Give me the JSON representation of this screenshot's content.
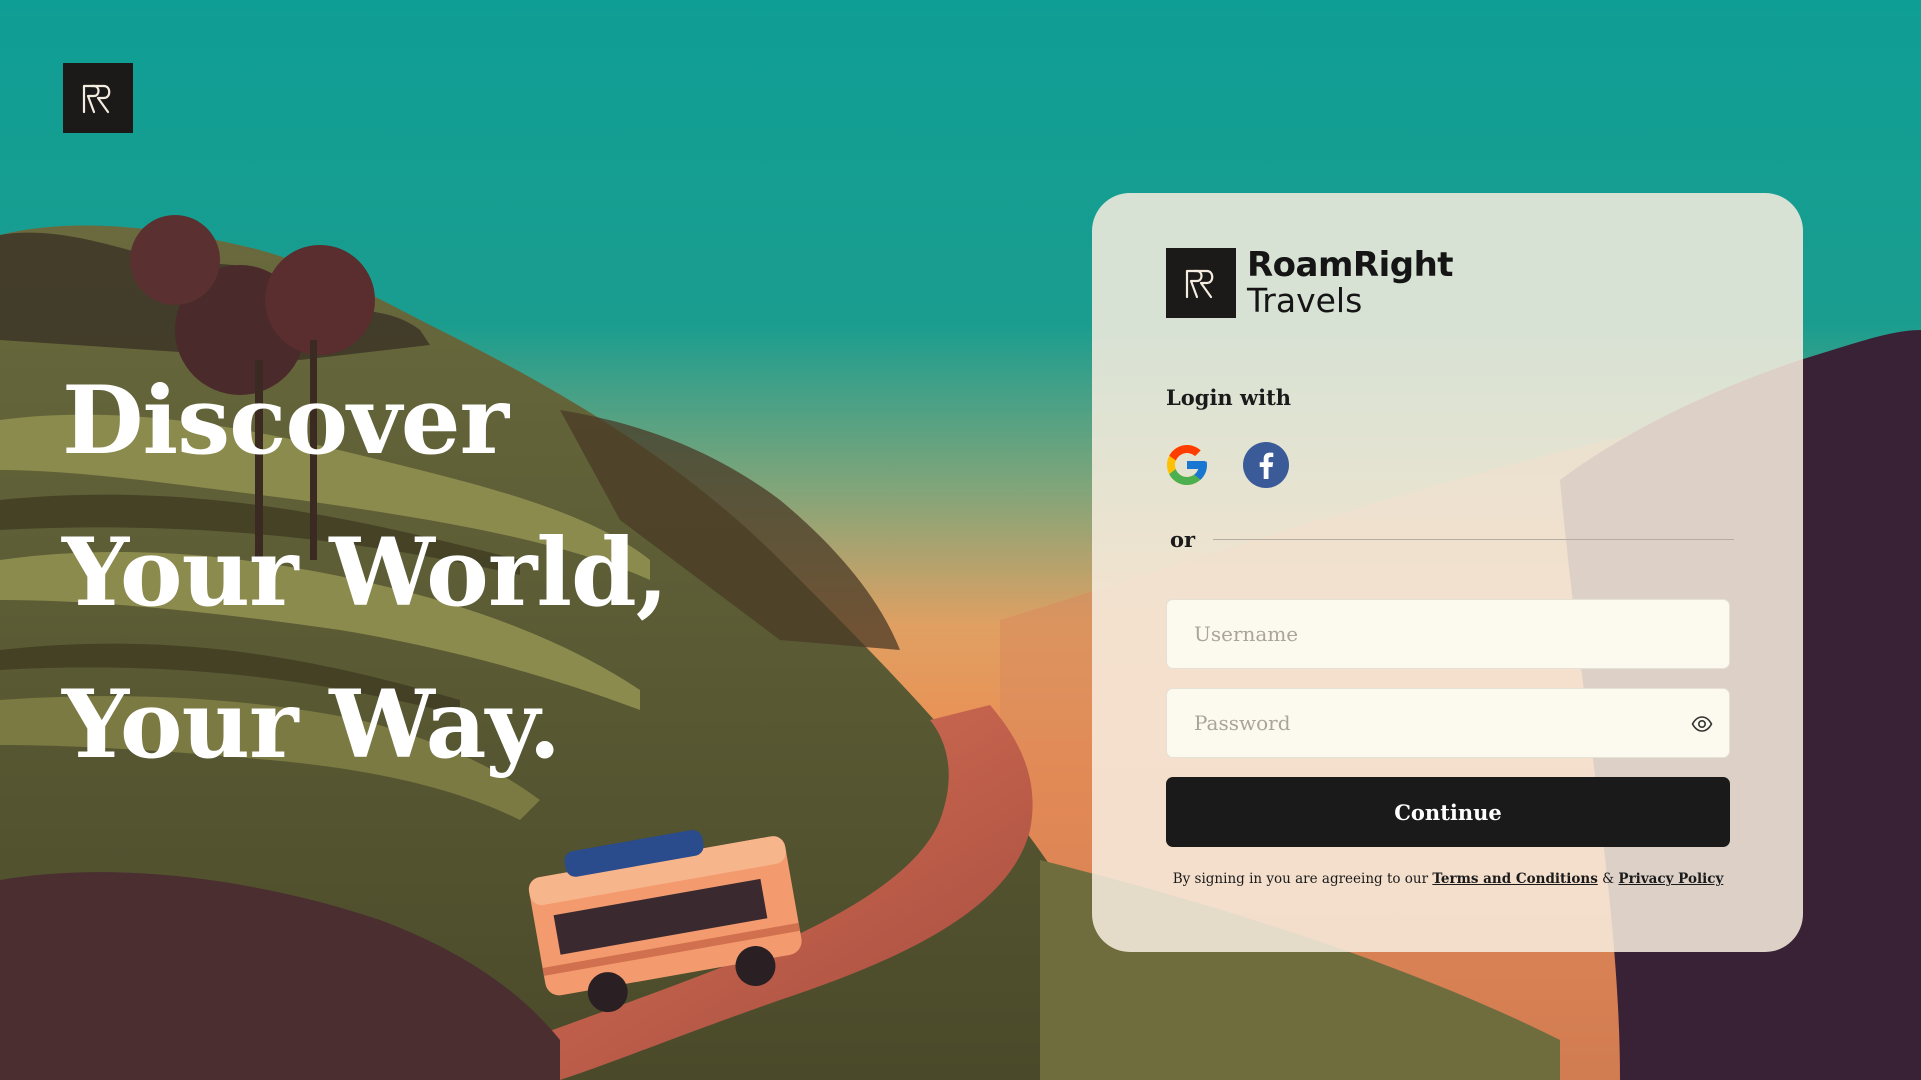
{
  "headline": {
    "line1": "Discover",
    "line2": "Your World,",
    "line3": "Your Way."
  },
  "brand": {
    "name": "RoamRight",
    "sub": "Travels"
  },
  "login": {
    "login_with": "Login with",
    "or": "or",
    "username_placeholder": "Username",
    "password_placeholder": "Password",
    "continue_label": "Continue",
    "legal_prefix": "By signing in you are agreeing to our",
    "terms_link": "Terms and Conditions",
    "amp": "&",
    "privacy_link": "Privacy Policy"
  },
  "icons": {
    "corner_logo": "rr-monogram-icon",
    "brand_logo": "rr-monogram-icon",
    "google": "google-icon",
    "facebook": "facebook-icon",
    "password_toggle": "eye-icon"
  },
  "colors": {
    "sky_top": "#0f9e95",
    "card_bg": "#f7eee0",
    "button_bg": "#1a1a1a",
    "facebook_blue": "#3a5a98"
  }
}
